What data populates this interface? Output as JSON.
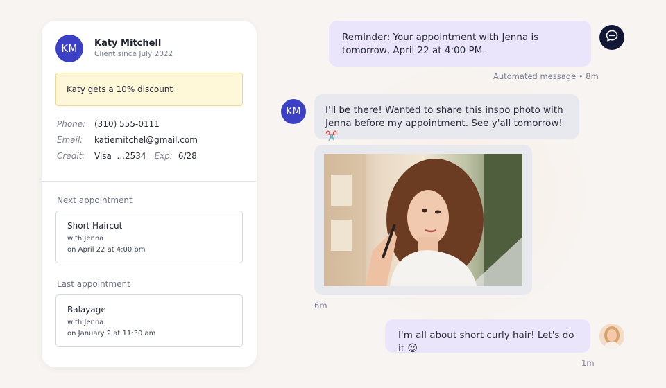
{
  "client": {
    "initials": "KM",
    "name": "Katy Mitchell",
    "since": "Client since July 2022",
    "discount": "Katy gets a 10% discount",
    "phone_label": "Phone:",
    "phone": "(310) 555-0111",
    "email_label": "Email:",
    "email": "katiemitchel@gmail.com",
    "credit_label": "Credit:",
    "credit": "Visa  ...2534",
    "exp_label": "Exp:",
    "exp": "6/28"
  },
  "next_appointment": {
    "heading": "Next appointment",
    "service": "Short Haircut",
    "with": "with Jenna",
    "when": "on April 22 at 4:00 pm"
  },
  "last_appointment": {
    "heading": "Last appointment",
    "service": "Balayage",
    "with": "with Jenna",
    "when": "on January 2 at 11:30 am"
  },
  "messages": [
    {
      "text": "Reminder: Your appointment with Jenna is tomorrow, April 22 at 4:00 PM.",
      "meta": "Automated message • 8m",
      "sender": "bot"
    },
    {
      "text": "I'll be there! Wanted to share this inspo photo with Jenna before my appointment. See y'all tomorrow!",
      "emoji": "✂️",
      "sender": "client",
      "initials": "KM"
    },
    {
      "attachment": "photo",
      "meta": "6m",
      "sender": "client"
    },
    {
      "text": "I'm all about short curly hair! Let's do it",
      "emoji": "😍",
      "meta": "1m",
      "sender": "staff"
    }
  ],
  "icons": {
    "bot_avatar": "chat-bubble-icon"
  },
  "colors": {
    "accent": "#3b40c4",
    "outgoing_bubble": "#ebe5fb",
    "incoming_bubble": "#e8e9ef",
    "discount_bg": "#fff8d8"
  }
}
